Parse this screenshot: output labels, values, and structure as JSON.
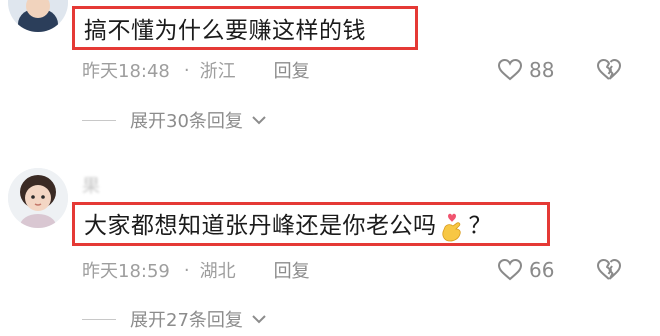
{
  "comments": [
    {
      "text": "搞不懂为什么要赚这样的钱",
      "time": "昨天18:48",
      "location": "浙江",
      "reply_label": "回复",
      "likes": "88",
      "expand_label": "展开30条回复"
    },
    {
      "username": "果",
      "text_main": "大家都想知道张丹峰还是你老公吗",
      "text_tail": "？",
      "emoji": "finger-heart-icon",
      "time": "昨天18:59",
      "location": "湖北",
      "reply_label": "回复",
      "likes": "66",
      "expand_label": "展开27条回复"
    }
  ],
  "colors": {
    "highlight_border": "#e53935",
    "meta_text": "#9e9e9e"
  }
}
